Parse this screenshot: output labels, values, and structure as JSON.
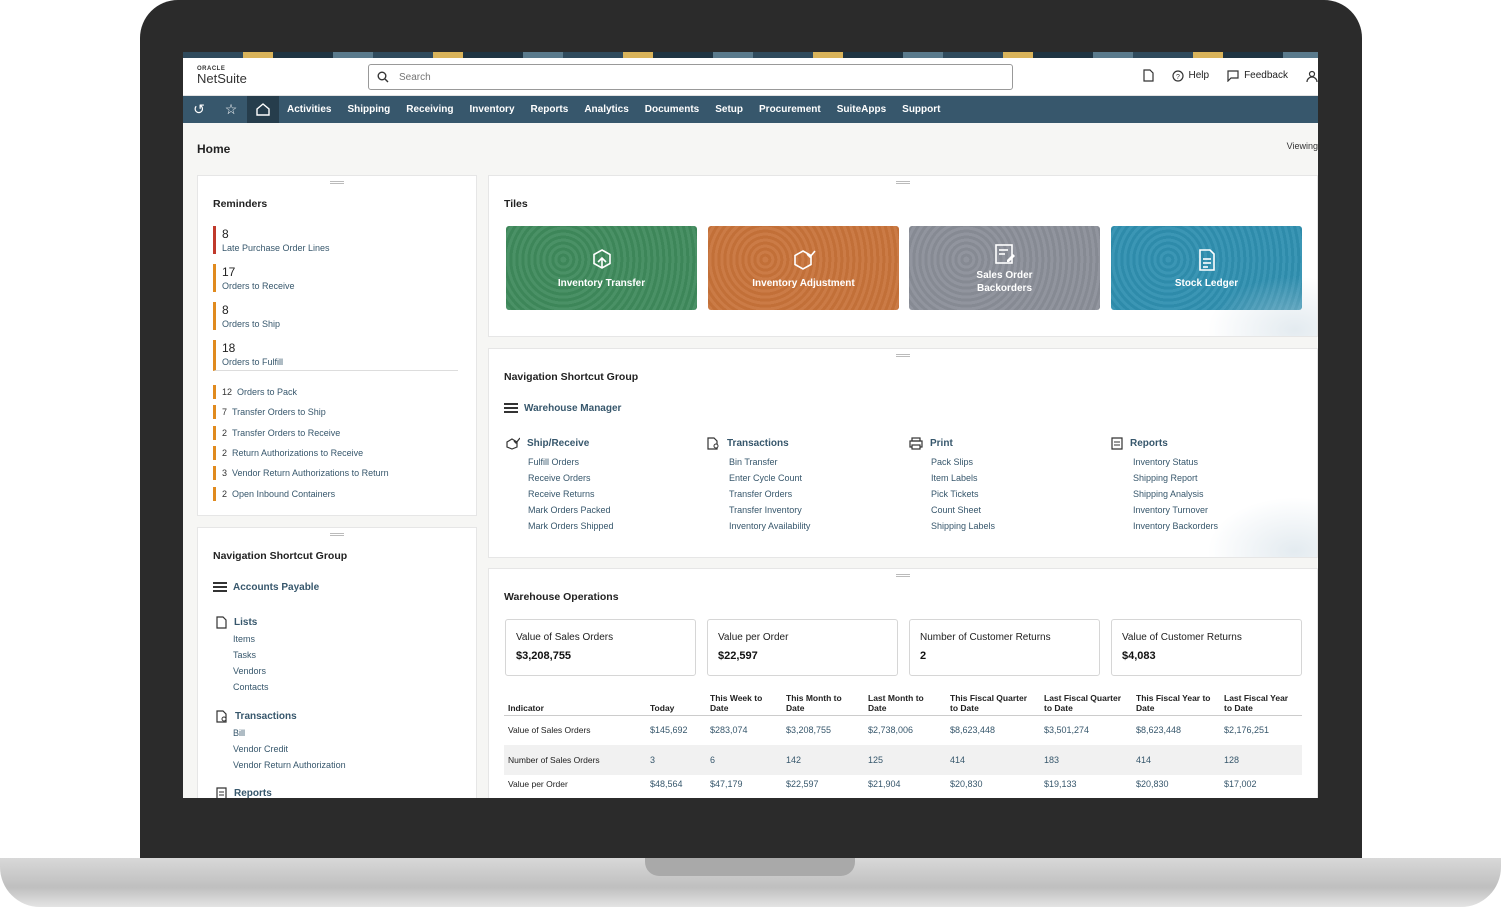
{
  "brand": {
    "oracle": "ORACLE",
    "netsuite": "NetSuite"
  },
  "search": {
    "placeholder": "Search"
  },
  "header": {
    "help": "Help",
    "feedback": "Feedback"
  },
  "nav": {
    "menus": [
      "Activities",
      "Shipping",
      "Receiving",
      "Inventory",
      "Reports",
      "Analytics",
      "Documents",
      "Setup",
      "Procurement",
      "SuiteApps",
      "Support"
    ]
  },
  "page": {
    "title": "Home",
    "viewing": "Viewing"
  },
  "reminders": {
    "title": "Reminders",
    "big": [
      {
        "count": "8",
        "label": "Late Purchase Order Lines",
        "color": "#c0392b"
      },
      {
        "count": "17",
        "label": "Orders to Receive",
        "color": "#e08a1e"
      },
      {
        "count": "8",
        "label": "Orders to Ship",
        "color": "#e08a1e"
      },
      {
        "count": "18",
        "label": "Orders to Fulfill",
        "color": "#e08a1e"
      }
    ],
    "small": [
      {
        "count": "12",
        "label": "Orders to Pack"
      },
      {
        "count": "7",
        "label": "Transfer Orders to Ship"
      },
      {
        "count": "2",
        "label": "Transfer Orders to Receive"
      },
      {
        "count": "2",
        "label": "Return Authorizations to Receive"
      },
      {
        "count": "3",
        "label": "Vendor Return Authorizations to Return"
      },
      {
        "count": "2",
        "label": "Open Inbound Containers"
      }
    ]
  },
  "left_shortcuts": {
    "title": "Navigation Shortcut Group",
    "group": "Accounts Payable",
    "lists": {
      "title": "Lists",
      "items": [
        "Items",
        "Tasks",
        "Vendors",
        "Contacts"
      ]
    },
    "transactions": {
      "title": "Transactions",
      "items": [
        "Bill",
        "Vendor Credit",
        "Vendor Return Authorization"
      ]
    },
    "reports": {
      "title": "Reports"
    }
  },
  "tiles": {
    "title": "Tiles",
    "items": [
      {
        "label": "Inventory Transfer",
        "color": "#3f8a5c"
      },
      {
        "label": "Inventory Adjustment",
        "color": "#c8733a"
      },
      {
        "label": "Sales Order\nBackorders",
        "color": "#8a8e98"
      },
      {
        "label": "Stock Ledger",
        "color": "#2f8fb0"
      }
    ]
  },
  "center_shortcuts": {
    "title": "Navigation Shortcut Group",
    "group": "Warehouse Manager",
    "columns": [
      {
        "title": "Ship/Receive",
        "icon": "check-badge-icon",
        "items": [
          "Fulfill Orders",
          "Receive Orders",
          "Receive Returns",
          "Mark Orders Packed",
          "Mark Orders Shipped"
        ]
      },
      {
        "title": "Transactions",
        "icon": "document-icon",
        "items": [
          "Bin Transfer",
          "Enter Cycle Count",
          "Transfer Orders",
          "Transfer Inventory",
          "Inventory Availability"
        ]
      },
      {
        "title": "Print",
        "icon": "printer-icon",
        "items": [
          "Pack Slips",
          "Item Labels",
          "Pick Tickets",
          "Count Sheet",
          "Shipping Labels"
        ]
      },
      {
        "title": "Reports",
        "icon": "report-icon",
        "items": [
          "Inventory Status",
          "Shipping Report",
          "Shipping Analysis",
          "Inventory Turnover",
          "Inventory Backorders"
        ]
      }
    ]
  },
  "warehouse": {
    "title": "Warehouse Operations",
    "kpis": [
      {
        "label": "Value of Sales Orders",
        "value": "$3,208,755"
      },
      {
        "label": "Value per Order",
        "value": "$22,597"
      },
      {
        "label": "Number of Customer Returns",
        "value": "2"
      },
      {
        "label": "Value of Customer Returns",
        "value": "$4,083"
      }
    ],
    "table": {
      "headers": [
        "Indicator",
        "Today",
        "This Week to Date",
        "This Month to Date",
        "Last Month to Date",
        "This Fiscal Quarter to Date",
        "Last Fiscal Quarter to Date",
        "This Fiscal Year to Date",
        "Last Fiscal Year to Date"
      ],
      "rows": [
        [
          "Value of Sales Orders",
          "$145,692",
          "$283,074",
          "$3,208,755",
          "$2,738,006",
          "$8,623,448",
          "$3,501,274",
          "$8,623,448",
          "$2,176,251"
        ],
        [
          "Number of Sales Orders",
          "3",
          "6",
          "142",
          "125",
          "414",
          "183",
          "414",
          "128"
        ],
        [
          "Value per Order",
          "$48,564",
          "$47,179",
          "$22,597",
          "$21,904",
          "$20,830",
          "$19,133",
          "$20,830",
          "$17,002"
        ]
      ]
    }
  }
}
